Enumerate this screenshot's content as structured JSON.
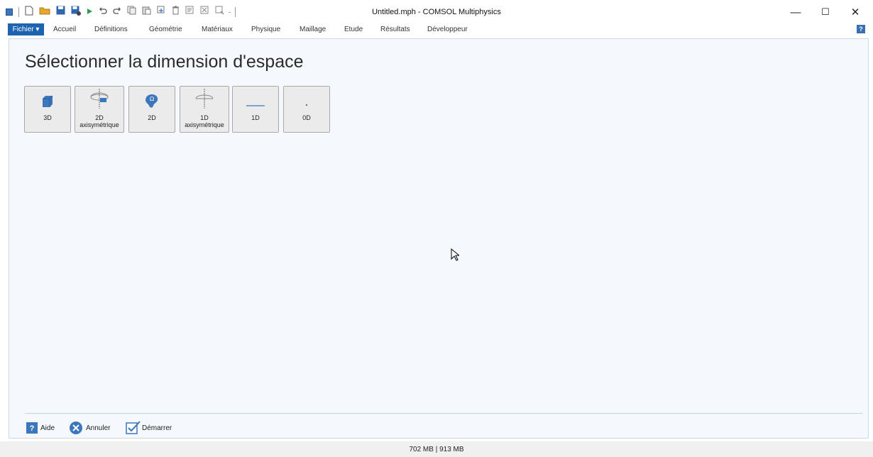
{
  "window": {
    "title": "Untitled.mph - COMSOL Multiphysics",
    "controls": {
      "minimize": "—",
      "maximize": "☐",
      "close": "✕"
    }
  },
  "quick_access": {
    "icons": [
      "app-icon",
      "new-file-icon",
      "open-folder-icon",
      "save-icon",
      "save-as-icon",
      "run-icon",
      "undo-icon",
      "redo-icon",
      "copy-icon",
      "paste-icon",
      "duplicate-icon",
      "delete-icon",
      "select-icon",
      "build-icon",
      "zoom-icon",
      "dropdown-icon"
    ]
  },
  "ribbon": {
    "file_menu": "Fichier ▾",
    "tabs": [
      "Accueil",
      "Définitions",
      "Géométrie",
      "Matériaux",
      "Physique",
      "Maillage",
      "Etude",
      "Résultats",
      "Développeur"
    ],
    "help": "?"
  },
  "main": {
    "heading": "Sélectionner la dimension d'espace",
    "dimensions": [
      {
        "label_line1": "3D",
        "label_line2": "",
        "icon": "cube-3d-icon"
      },
      {
        "label_line1": "2D",
        "label_line2": "axisymétrique",
        "icon": "axisymmetric-2d-icon"
      },
      {
        "label_line1": "2D",
        "label_line2": "",
        "icon": "omega-2d-icon"
      },
      {
        "label_line1": "1D",
        "label_line2": "axisymétrique",
        "icon": "axisymmetric-1d-icon"
      },
      {
        "label_line1": "1D",
        "label_line2": "",
        "icon": "line-1d-icon"
      },
      {
        "label_line1": "0D",
        "label_line2": "",
        "icon": "point-0d-icon"
      }
    ]
  },
  "footer": {
    "help": "Aide",
    "cancel": "Annuler",
    "start": "Démarrer"
  },
  "status": {
    "memory": "702 MB | 913 MB"
  },
  "colors": {
    "accent": "#1d63b0",
    "panel_bg": "#f5f8fc",
    "button_bg": "#ebebeb",
    "icon_blue": "#3c76bd"
  }
}
